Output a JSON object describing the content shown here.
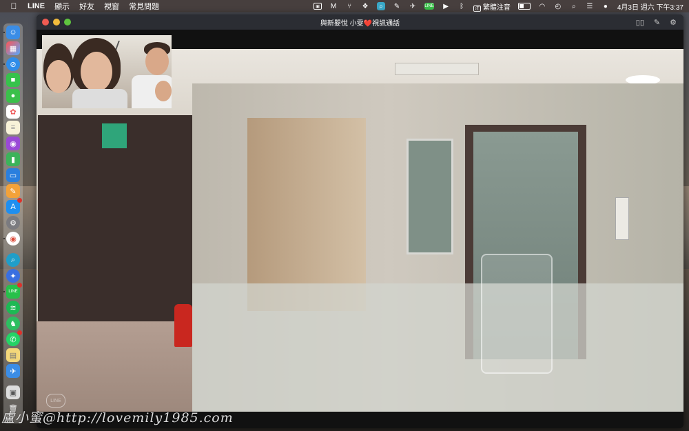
{
  "menubar": {
    "apple": "",
    "app_name": "LINE",
    "menus": [
      "顯示",
      "好友",
      "視窗",
      "常見問題"
    ],
    "input_method": "繁體注音",
    "line_status_icon": "LINE",
    "datetime": "4月3日 週六 下午3:37"
  },
  "window": {
    "title_prefix": "與新嬰悅 小雯",
    "title_heart": "❤️",
    "title_suffix": "視訊通話",
    "line_logo_text": "LINE"
  },
  "watermark": "盧小蜜@http://lovemily1985.com",
  "dock": {
    "items": [
      "finder-icon",
      "launchpad-icon",
      "safari-icon",
      "facetime-icon",
      "messages-icon",
      "photos-icon",
      "notes-icon",
      "podcasts-icon",
      "numbers-icon",
      "keynote-icon",
      "pages-icon",
      "app-store-icon",
      "system-preferences-icon",
      "chrome-icon",
      "magnifier-app-icon",
      "network-app-icon",
      "line-icon",
      "spotify-icon",
      "evernote-icon",
      "whatsapp-icon",
      "stickies-icon",
      "send-app-icon",
      "preview-icon",
      "trash-icon"
    ]
  },
  "colors": {
    "menubar_bg": "#463e3c",
    "titlebar_bg": "#2b2d33",
    "close": "#ee5b52",
    "minimize": "#f2bb3c",
    "maximize": "#5fc53f",
    "heart": "#e3283a"
  }
}
